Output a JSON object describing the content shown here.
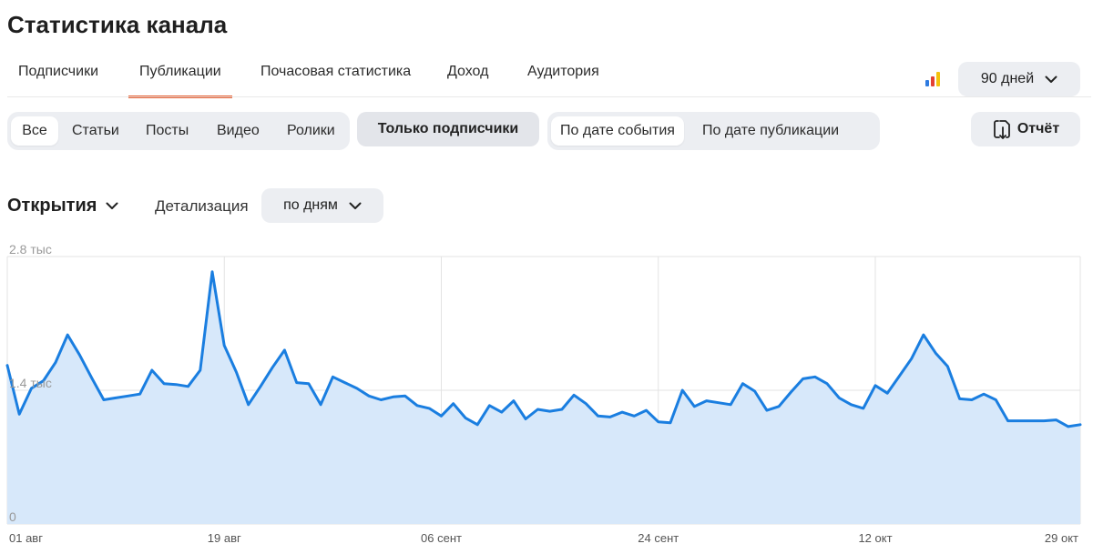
{
  "page": {
    "title": "Статистика канала"
  },
  "tabs": [
    {
      "label": "Подписчики",
      "active": false
    },
    {
      "label": "Публикации",
      "active": true
    },
    {
      "label": "Почасовая статистика",
      "active": false
    },
    {
      "label": "Доход",
      "active": false
    },
    {
      "label": "Аудитория",
      "active": false
    }
  ],
  "period": {
    "value": "90 дней",
    "icon": "chevron-down-icon"
  },
  "brand_colors": {
    "bar1": "#2e7be0",
    "bar2": "#e34234",
    "bar3": "#f4c20d",
    "accent": "#e55b2c",
    "line": "#1a7ee0",
    "area": "#d7e8fa"
  },
  "content_filter": {
    "items": [
      "Все",
      "Статьи",
      "Посты",
      "Видео",
      "Ролики"
    ],
    "selected": "Все"
  },
  "subscribers_only": {
    "label": "Только подписчики"
  },
  "date_mode": {
    "items": [
      "По дате события",
      "По дате публикации"
    ],
    "selected": "По дате события"
  },
  "report": {
    "label": "Отчёт",
    "icon": "export-icon"
  },
  "metric": {
    "label": "Открытия",
    "icon": "chevron-down-icon"
  },
  "detail": {
    "label": "Детализация",
    "value": "по дням"
  },
  "chart_data": {
    "type": "area",
    "title": "",
    "xlabel": "",
    "ylabel": "",
    "y_ticks": [
      "2.8 тыс",
      "1.4 тыс",
      "0"
    ],
    "ylim": [
      0,
      2800
    ],
    "x_ticks": [
      "01 авг",
      "19 авг",
      "06 сент",
      "24 сент",
      "12 окт",
      "29 окт"
    ],
    "x_tick_days": [
      0,
      18,
      36,
      54,
      72,
      89
    ],
    "grid": true,
    "x": [
      0,
      1,
      2,
      3,
      4,
      5,
      6,
      7,
      8,
      9,
      10,
      11,
      12,
      13,
      14,
      15,
      16,
      17,
      18,
      19,
      20,
      21,
      22,
      23,
      24,
      25,
      26,
      27,
      28,
      29,
      30,
      31,
      32,
      33,
      34,
      35,
      36,
      37,
      38,
      39,
      40,
      41,
      42,
      43,
      44,
      45,
      46,
      47,
      48,
      49,
      50,
      51,
      52,
      53,
      54,
      55,
      56,
      57,
      58,
      59,
      60,
      61,
      62,
      63,
      64,
      65,
      66,
      67,
      68,
      69,
      70,
      71,
      72,
      73,
      74,
      75,
      76,
      77,
      78,
      79,
      80,
      81,
      82,
      83,
      84,
      85,
      86,
      87,
      88,
      89
    ],
    "values": [
      1660,
      1150,
      1420,
      1500,
      1690,
      1980,
      1770,
      1530,
      1300,
      1320,
      1340,
      1360,
      1610,
      1470,
      1460,
      1440,
      1610,
      2640,
      1870,
      1590,
      1250,
      1440,
      1640,
      1820,
      1480,
      1470,
      1250,
      1540,
      1480,
      1420,
      1340,
      1300,
      1330,
      1340,
      1240,
      1210,
      1130,
      1260,
      1110,
      1040,
      1240,
      1170,
      1290,
      1100,
      1200,
      1180,
      1200,
      1350,
      1260,
      1130,
      1120,
      1170,
      1130,
      1190,
      1070,
      1060,
      1400,
      1230,
      1290,
      1270,
      1250,
      1470,
      1390,
      1190,
      1230,
      1380,
      1520,
      1540,
      1470,
      1320,
      1250,
      1210,
      1450,
      1370,
      1550,
      1730,
      1980,
      1790,
      1650,
      1310,
      1300,
      1360,
      1300,
      1080,
      1080,
      1080,
      1080,
      1090,
      1020,
      1040
    ]
  }
}
